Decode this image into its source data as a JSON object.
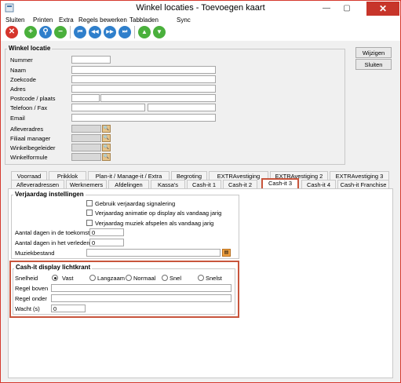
{
  "window": {
    "title": "Winkel locaties - Toevoegen kaart",
    "close_glyph": "✕",
    "min_glyph": "—",
    "max_glyph": "▢"
  },
  "menu": [
    "Sluiten",
    "Printen",
    "Extra",
    "Regels bewerken",
    "Tabbladen",
    "Sync"
  ],
  "toolbar": [
    {
      "name": "delete-icon",
      "glyph": "✕",
      "color": "red"
    },
    {
      "name": "add-icon",
      "glyph": "+",
      "color": "green"
    },
    {
      "name": "search-icon",
      "glyph": "⚲",
      "color": "blue"
    },
    {
      "name": "remove-icon",
      "glyph": "−",
      "color": "green"
    },
    {
      "name": "first-icon",
      "glyph": "⏮",
      "color": "blue"
    },
    {
      "name": "previous-icon",
      "glyph": "◀◀",
      "color": "blue"
    },
    {
      "name": "next-icon",
      "glyph": "▶▶",
      "color": "blue"
    },
    {
      "name": "last-icon",
      "glyph": "⏭",
      "color": "blue"
    },
    {
      "name": "up-icon",
      "glyph": "▲",
      "color": "green"
    },
    {
      "name": "down-icon",
      "glyph": "▼",
      "color": "green"
    }
  ],
  "winkel": {
    "group_title": "Winkel locatie",
    "fields": {
      "nummer": "Nummer",
      "naam": "Naam",
      "zoekcode": "Zoekcode",
      "adres": "Adres",
      "postcode": "Postcode / plaats",
      "telefoon": "Telefoon / Fax",
      "email": "Email",
      "afleveradres": "Afleveradres",
      "filiaal": "Filiaal manager",
      "begeleider": "Winkelbegeleider",
      "formule": "Winkelformule"
    }
  },
  "buttons": {
    "wijzigen": "Wijzigen",
    "sluiten": "Sluiten"
  },
  "tabs_row1": [
    "Voorraad",
    "Prikklok",
    "Plan-it / Manage-it / Extra",
    "Begroting",
    "EXTRAvestiging",
    "EXTRAvestiging 2",
    "EXTRAvestiging 3"
  ],
  "tabs_row2": [
    "Afleveradressen",
    "Werknemers",
    "Afdelingen",
    "Kassa's",
    "Cash-it 1",
    "Cash-it 2",
    "Cash-it 3",
    "Cash-it 4",
    "Cash-it Franchise"
  ],
  "verjaardag": {
    "group_title": "Verjaardag instellingen",
    "check1": "Gebruik verjaardag signalering",
    "check2": "Verjaardag animatie op display als vandaag jarig",
    "check3": "Verjaardag muziek afspelen als vandaag jarig",
    "toekomst_label": "Aantal dagen in de toekomst",
    "toekomst_value": "0",
    "verleden_label": "Aantal dagen in het verleden",
    "verleden_value": "0",
    "muziek_label": "Muziekbestand"
  },
  "lichtkrant": {
    "group_title": "Cash-it display lichtkrant",
    "snelheid_label": "Snelheid",
    "speeds": [
      "Vast",
      "Langzaam",
      "Normaal",
      "Snel",
      "Snelst"
    ],
    "selected": "Vast",
    "boven_label": "Regel boven",
    "onder_label": "Regel onder",
    "wacht_label": "Wacht (s)",
    "wacht_value": "0"
  }
}
